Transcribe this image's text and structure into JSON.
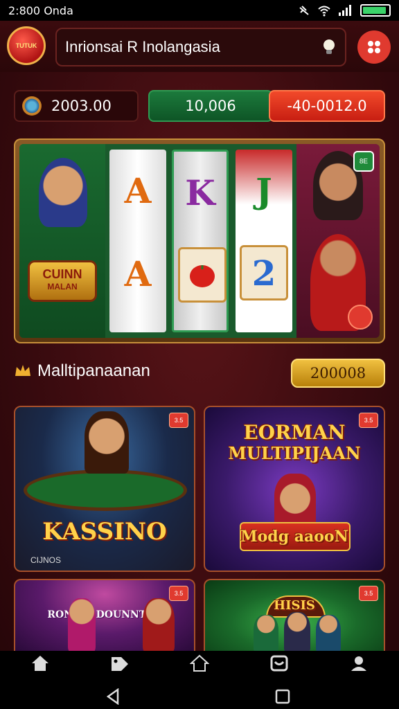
{
  "status": {
    "time": "2:800 Onda"
  },
  "header": {
    "logo_text": "TUTUK",
    "search_text": "Inrionsai R Inolangasia"
  },
  "balances": {
    "coins": "2003.00",
    "green": "10,006",
    "red": "-40-0012.0"
  },
  "slot": {
    "badge": "8E",
    "title_line1": "CUINN",
    "title_line2": "MALAN",
    "symbols": [
      "A",
      "K",
      "J",
      "A",
      "",
      "2"
    ]
  },
  "section": {
    "title": "Malltipanaanan",
    "pill": "200008"
  },
  "cards": [
    {
      "title": "KASSINO",
      "badge": "3.5",
      "caption": "CIJNOS"
    },
    {
      "title_line1": "EORMAN",
      "title_line2": "MULTIPIJAAN",
      "subtitle": "Modg aaooN",
      "badge": "3.5"
    },
    {
      "title": "RONDSI DOUNNTER",
      "badge": "3.5"
    },
    {
      "title": "HISIS",
      "badge": "3.5"
    }
  ],
  "icons": {
    "home": "home-icon",
    "tag": "tag-icon",
    "house": "home-outline-icon",
    "wallet": "wallet-icon",
    "profile": "profile-icon"
  },
  "colors": {
    "background": "#3a0b0f",
    "accent_red": "#e03a2f",
    "accent_green": "#1c7a3c",
    "gold": "#f0c040"
  }
}
